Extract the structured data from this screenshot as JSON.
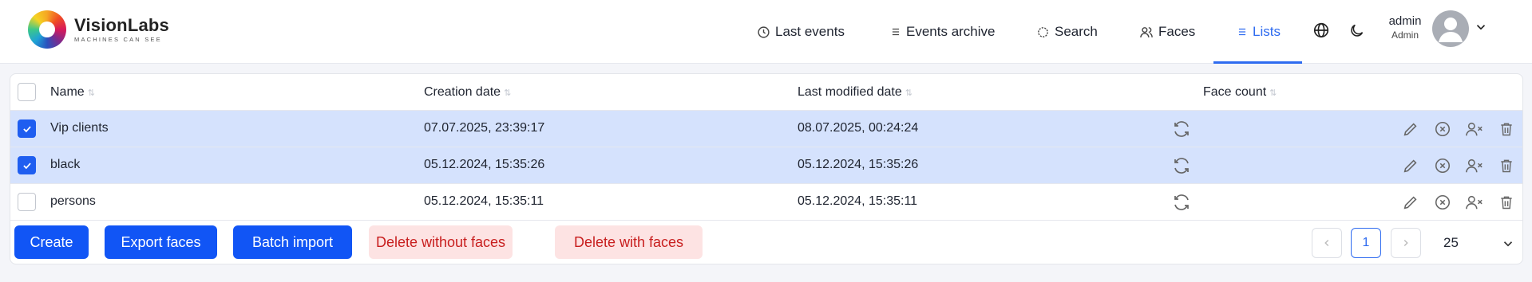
{
  "brand": {
    "name": "VisionLabs",
    "tagline": "MACHINES CAN SEE"
  },
  "nav": {
    "items": [
      {
        "label": "Last events",
        "icon": "clock-icon"
      },
      {
        "label": "Events archive",
        "icon": "list-icon"
      },
      {
        "label": "Search",
        "icon": "target-icon"
      },
      {
        "label": "Faces",
        "icon": "users-icon"
      },
      {
        "label": "Lists",
        "icon": "list-icon",
        "active": true
      }
    ]
  },
  "user": {
    "name": "admin",
    "role": "Admin"
  },
  "table": {
    "columns": [
      "Name",
      "Creation date",
      "Last modified date",
      "Face count"
    ],
    "rows": [
      {
        "name": "Vip clients",
        "created": "07.07.2025, 23:39:17",
        "modified": "08.07.2025, 00:24:24",
        "selected": true
      },
      {
        "name": "black",
        "created": "05.12.2024, 15:35:26",
        "modified": "05.12.2024, 15:35:26",
        "selected": true
      },
      {
        "name": "persons",
        "created": "05.12.2024, 15:35:11",
        "modified": "05.12.2024, 15:35:11",
        "selected": false
      }
    ]
  },
  "actions": {
    "create": "Create",
    "export_faces": "Export faces",
    "batch_import": "Batch import",
    "delete_without_faces": "Delete without faces",
    "delete_with_faces": "Delete with faces"
  },
  "pagination": {
    "current_page": "1",
    "page_size": "25"
  },
  "colors": {
    "accent": "#2e6bf0",
    "primary_button": "#1155f5",
    "selected_row": "#d5e2fd",
    "danger_text": "#c81e1e",
    "danger_bg": "#fde3e3"
  }
}
